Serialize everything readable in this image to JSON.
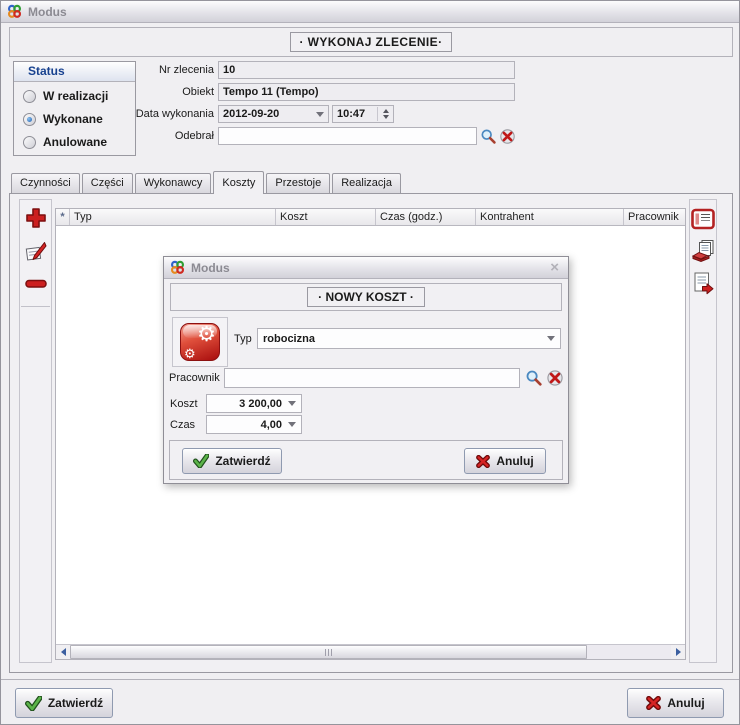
{
  "colors": {
    "accent_blue": "#17418f",
    "action_red": "#cc1f1f",
    "action_green": "#58b048"
  },
  "window": {
    "title": "Modus"
  },
  "header": {
    "title": "· WYKONAJ ZLECENIE·"
  },
  "status_box": {
    "title": "Status",
    "options": [
      {
        "label": "W realizacji",
        "selected": false
      },
      {
        "label": "Wykonane",
        "selected": true
      },
      {
        "label": "Anulowane",
        "selected": false
      }
    ]
  },
  "form": {
    "nr_zlecenia": {
      "label": "Nr zlecenia",
      "value": "10"
    },
    "obiekt": {
      "label": "Obiekt",
      "value": "Tempo 11 (Tempo)"
    },
    "data_wykonania": {
      "label": "Data wykonania",
      "date": "2012-09-20",
      "time": "10:47"
    },
    "odebral": {
      "label": "Odebrał",
      "value": ""
    }
  },
  "tabs": [
    {
      "label": "Czynności",
      "active": false
    },
    {
      "label": "Części",
      "active": false
    },
    {
      "label": "Wykonawcy",
      "active": false
    },
    {
      "label": "Koszty",
      "active": true
    },
    {
      "label": "Przestoje",
      "active": false
    },
    {
      "label": "Realizacja",
      "active": false
    }
  ],
  "table": {
    "columns": [
      "*",
      "Typ",
      "Koszt",
      "Czas (godz.)",
      "Kontrahent",
      "Pracownik"
    ],
    "rows": []
  },
  "toolbar_left": {
    "icons": [
      "add",
      "edit",
      "remove"
    ]
  },
  "toolbar_right": {
    "icons": [
      "grid-view",
      "print",
      "export"
    ]
  },
  "dialog": {
    "title": "Modus",
    "header": "· NOWY KOSZT ·",
    "typ": {
      "label": "Typ",
      "value": "robocizna"
    },
    "pracownik": {
      "label": "Pracownik",
      "value": ""
    },
    "koszt": {
      "label": "Koszt",
      "value": "3 200,00"
    },
    "czas": {
      "label": "Czas",
      "value": "4,00"
    },
    "buttons": {
      "ok": "Zatwierdź",
      "cancel": "Anuluj"
    }
  },
  "footer": {
    "ok": "Zatwierdź",
    "cancel": "Anuluj"
  }
}
